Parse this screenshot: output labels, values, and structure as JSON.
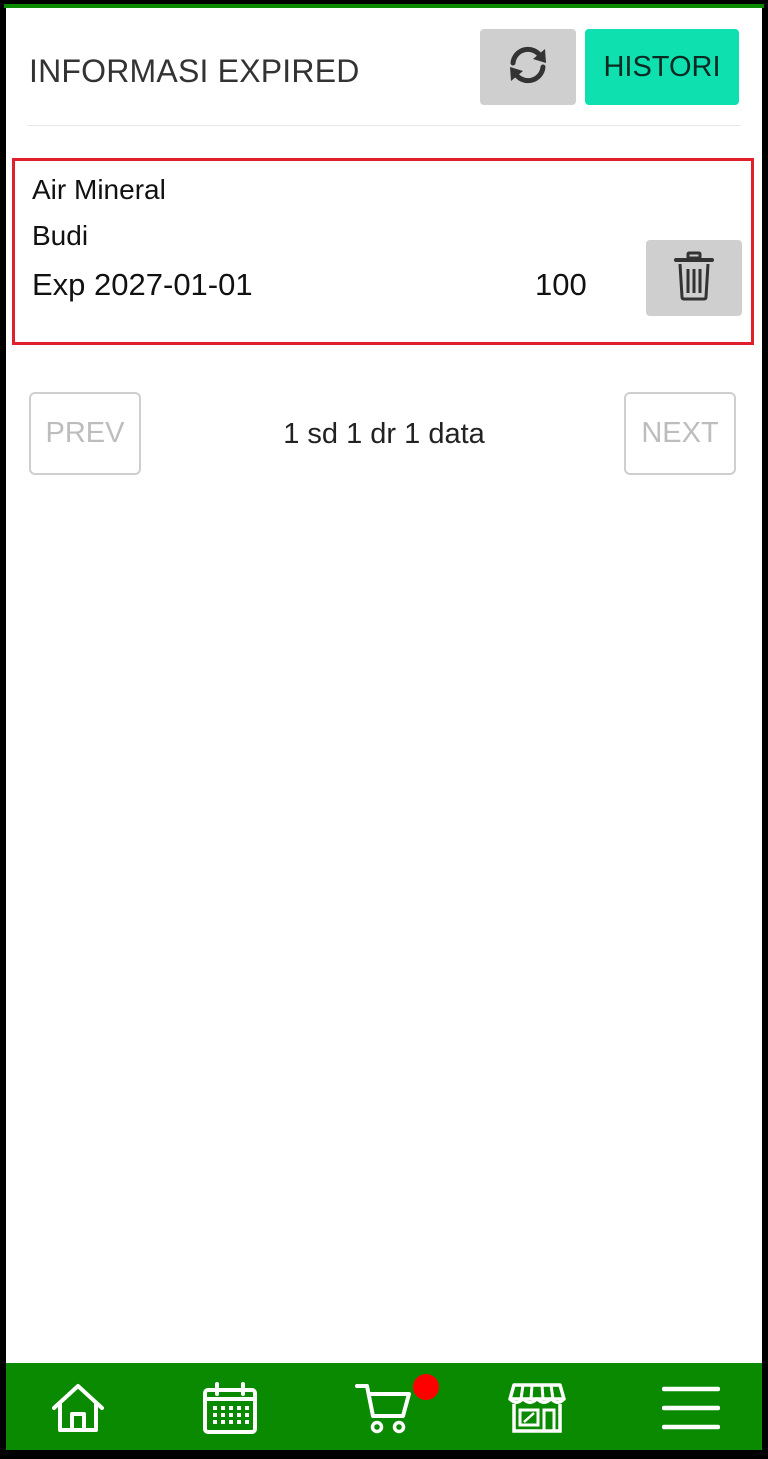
{
  "header": {
    "title": "INFORMASI EXPIRED",
    "refresh_icon": "refresh-icon",
    "histori_label": "HISTORI"
  },
  "items": [
    {
      "name": "Air Mineral",
      "user": "Budi",
      "exp": "Exp 2027-01-01",
      "qty": "100",
      "delete_icon": "trash-icon"
    }
  ],
  "pagination": {
    "prev_label": "PREV",
    "info": "1 sd 1 dr 1 data",
    "next_label": "NEXT"
  },
  "bottom_nav": {
    "items": [
      {
        "icon": "home-icon"
      },
      {
        "icon": "calendar-icon"
      },
      {
        "icon": "cart-icon",
        "badge": true
      },
      {
        "icon": "store-icon"
      },
      {
        "icon": "menu-icon"
      }
    ]
  },
  "colors": {
    "accent": "#0ee0b0",
    "nav_bg": "#098a00",
    "card_border": "#e0202a",
    "badge": "#ff0000"
  }
}
